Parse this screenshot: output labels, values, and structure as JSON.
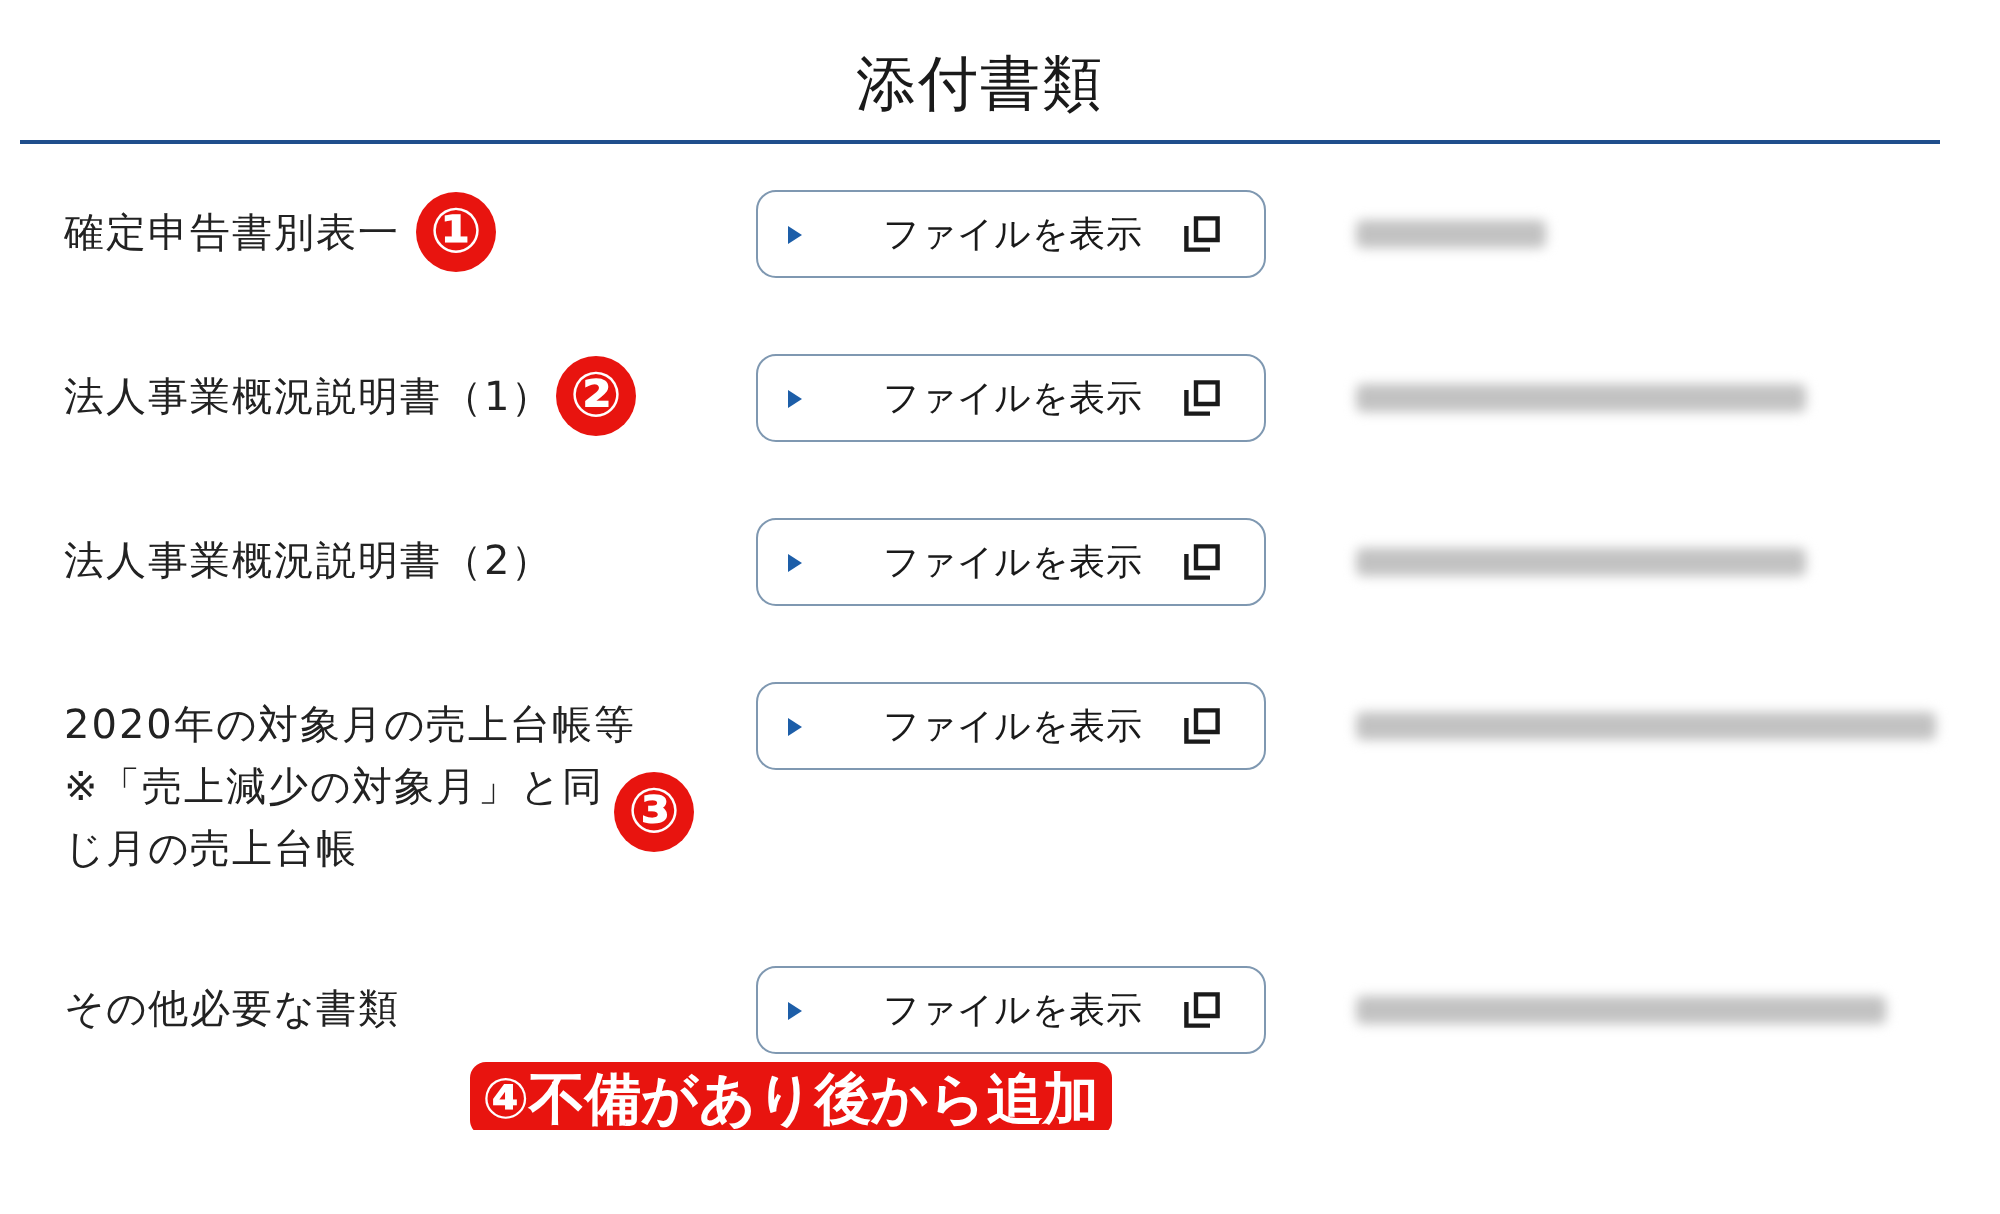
{
  "title": "添付書類",
  "rows": [
    {
      "label": "確定申告書別表一",
      "button": "ファイルを表示",
      "file_name_blurred": true,
      "annotation": {
        "kind": "badge",
        "text": "①"
      }
    },
    {
      "label": "法人事業概況説明書（1）",
      "button": "ファイルを表示",
      "file_name_blurred": true,
      "annotation": {
        "kind": "badge",
        "text": "②"
      }
    },
    {
      "label": "法人事業概況説明書（2）",
      "button": "ファイルを表示",
      "file_name_blurred": true
    },
    {
      "label": "2020年の対象月の売上台帳等",
      "note": "※「売上減少の対象月」と同じ月の売上台帳",
      "button": "ファイルを表示",
      "file_name_blurred": true,
      "annotation": {
        "kind": "badge",
        "text": "③"
      }
    },
    {
      "label": "その他必要な書類",
      "button": "ファイルを表示",
      "file_name_blurred": true,
      "annotation": {
        "kind": "label",
        "text": "④不備があり後から追加"
      }
    }
  ]
}
